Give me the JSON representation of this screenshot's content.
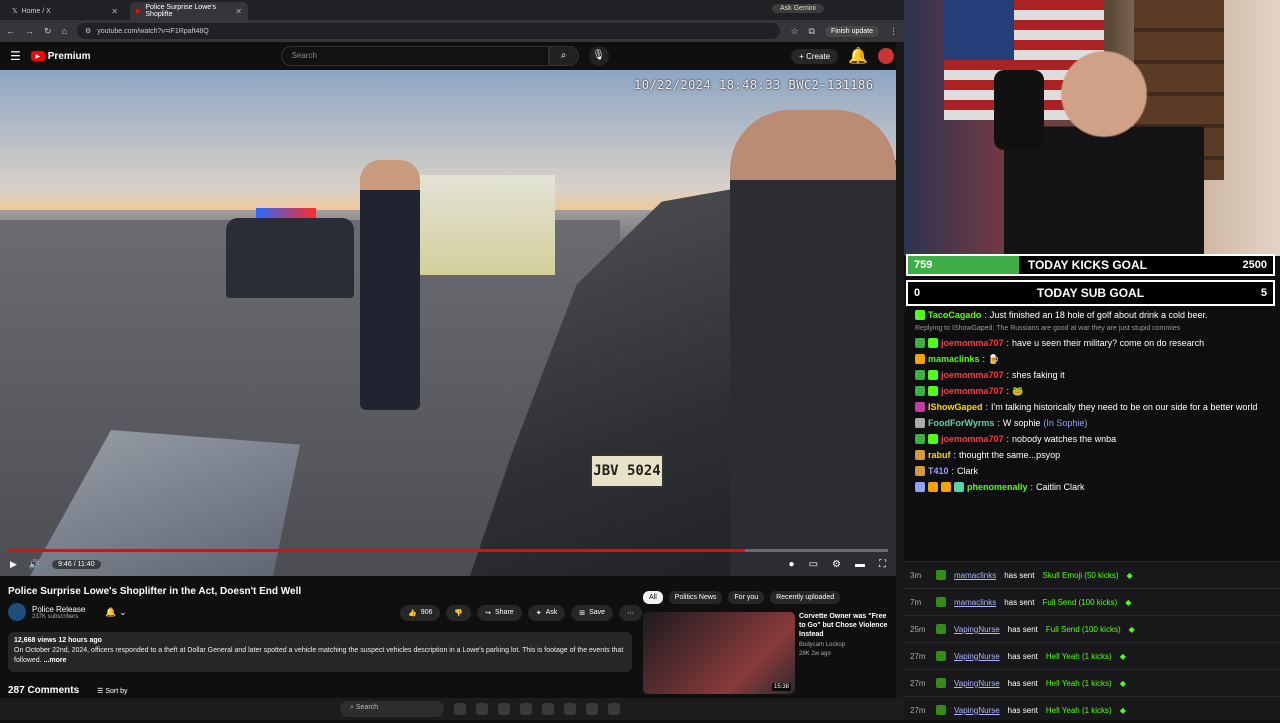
{
  "browser": {
    "tabs": [
      {
        "title": "Home / X"
      },
      {
        "title": "Police Surprise Lowe's Shoplifte"
      }
    ],
    "ask_gemini": "Ask Gemini",
    "url": "youtube.com/watch?v=iF1Rpaft48Q",
    "finish_update": "Finish update"
  },
  "youtube": {
    "logo_text": "Premium",
    "search_placeholder": "Search",
    "create_label": "Create",
    "video": {
      "timestamp": "10/22/2024  18:48:33   BWC2-131186",
      "plate": "JBV 5024",
      "time_display": "9:46 / 11:40",
      "progress_fraction": 0.838
    },
    "title": "Police Surprise Lowe's Shoplifter in the Act, Doesn't End Well",
    "channel": {
      "name": "Police Release",
      "subs": "237K subscribers"
    },
    "actions": {
      "likes": "906",
      "share": "Share",
      "ask": "Ask",
      "save": "Save"
    },
    "description": {
      "meta": "12,668 views  12 hours ago",
      "text": "On October 22nd, 2024, officers responded to a theft at Dollar General and later spotted a vehicle matching the suspect vehicles description in a Lowe's parking lot. This is footage of the events that followed.",
      "more": "...more"
    },
    "comments": {
      "count": "287 Comments",
      "sort": "Sort by"
    },
    "chips": [
      "All",
      "Politics News",
      "For you",
      "Recently uploaded"
    ],
    "recommended": {
      "title": "Corvette Owner was \"Free to Go\" but Chose Violence Instead",
      "channel": "Bodycam Lockup",
      "meta": "28K  2w ago",
      "duration": "15:38"
    }
  },
  "taskbar": {
    "search": "Search"
  },
  "stream": {
    "kicks_goal": {
      "current": "759",
      "label": "TODAY KICKS GOAL",
      "target": "2500",
      "fraction": 0.3036
    },
    "sub_goal": {
      "current": "0",
      "label": "TODAY SUB GOAL",
      "target": "5"
    },
    "chat": [
      {
        "user": "TacoCagado",
        "color": "#53fc18",
        "text": "Just finished an 18 hole of golf about drink a cold beer."
      },
      {
        "reply": "Replying to IShowGaped: The Russians are good at war they are just stupid commies"
      },
      {
        "user": "joemomma707",
        "color": "#ff3b3b",
        "text": "have u seen their military? come on do research"
      },
      {
        "user": "mamaclinks",
        "color": "#53fc18",
        "text": ""
      },
      {
        "user": "joemomma707",
        "color": "#ff3b3b",
        "text": "shes faking it"
      },
      {
        "user": "joemomma707",
        "color": "#ff3b3b",
        "text": ""
      },
      {
        "user": "IShowGaped",
        "color": "#ffd400",
        "text": "I'm talking historically they need to be on our side for a better world"
      },
      {
        "user": "FoodForWyrms",
        "color": "#5bd3a9",
        "text": "W sophie",
        "extra": "(In Sophie)"
      },
      {
        "user": "joemomma707",
        "color": "#ff3b3b",
        "text": "nobody watches the wnba"
      },
      {
        "user": "rabuf",
        "color": "#ffd400",
        "text": "thought the same...psyop"
      },
      {
        "user": "T410",
        "color": "#8fa3ff",
        "text": "Clark"
      },
      {
        "user": "phenomenally",
        "color": "#53fc18",
        "text": "Caitlin Clark"
      }
    ],
    "alerts": [
      {
        "time": "3m",
        "user": "mamaclinks",
        "verb": "has sent",
        "item": "Skull Emoji (50 kicks)"
      },
      {
        "time": "7m",
        "user": "mamaclinks",
        "verb": "has sent",
        "item": "Full Send (100 kicks)"
      },
      {
        "time": "25m",
        "user": "VapingNurse",
        "verb": "has sent",
        "item": "Full Send (100 kicks)"
      },
      {
        "time": "27m",
        "user": "VapingNurse",
        "verb": "has sent",
        "item": "Hell Yeah (1 kicks)"
      },
      {
        "time": "27m",
        "user": "VapingNurse",
        "verb": "has sent",
        "item": "Hell Yeah (1 kicks)"
      },
      {
        "time": "27m",
        "user": "VapingNurse",
        "verb": "has sent",
        "item": "Hell Yeah (1 kicks)"
      }
    ]
  }
}
